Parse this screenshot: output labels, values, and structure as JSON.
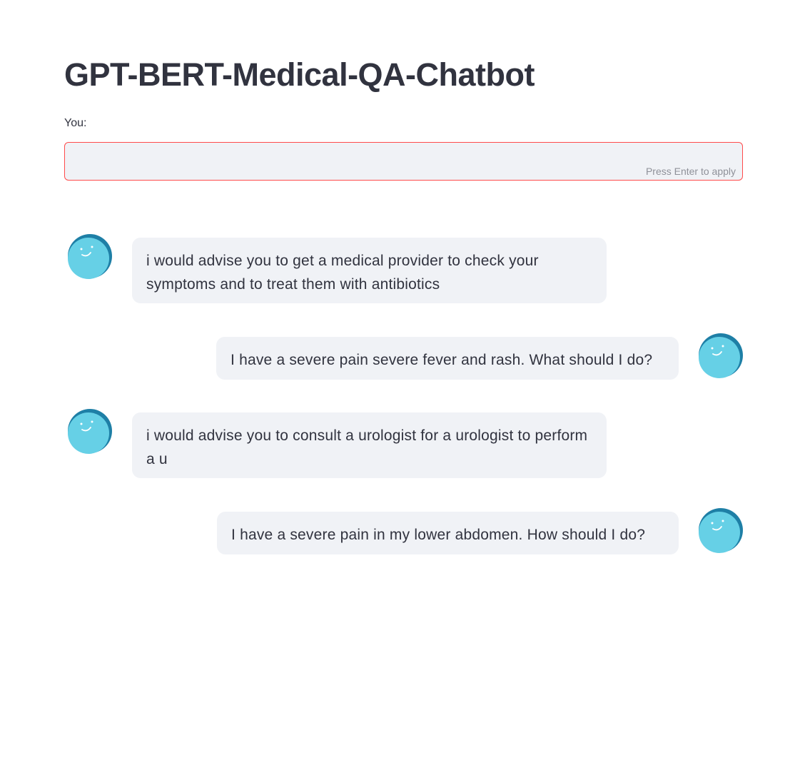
{
  "app": {
    "title": "GPT-BERT-Medical-QA-Chatbot"
  },
  "input": {
    "label": "You:",
    "value": "",
    "hint": "Press Enter to apply"
  },
  "messages": [
    {
      "role": "bot",
      "avatar_icon": "smiley-avatar-icon",
      "text": "i would advise you to get a medical provider to check your symptoms and to treat them with antibiotics"
    },
    {
      "role": "user",
      "avatar_icon": "smiley-avatar-icon",
      "text": "I have a severe pain severe fever and rash. What should I do?"
    },
    {
      "role": "bot",
      "avatar_icon": "smiley-avatar-icon",
      "text": "i would advise you to consult a urologist for a urologist to perform a u"
    },
    {
      "role": "user",
      "avatar_icon": "smiley-avatar-icon",
      "text": "I have a severe pain in my lower abdomen. How should I do?"
    }
  ],
  "colors": {
    "avatar_light": "#66d0e6",
    "avatar_dark": "#1e7fa6",
    "bubble_bg": "#f0f2f6",
    "input_border": "#ff4b4b",
    "text": "#31333f"
  }
}
